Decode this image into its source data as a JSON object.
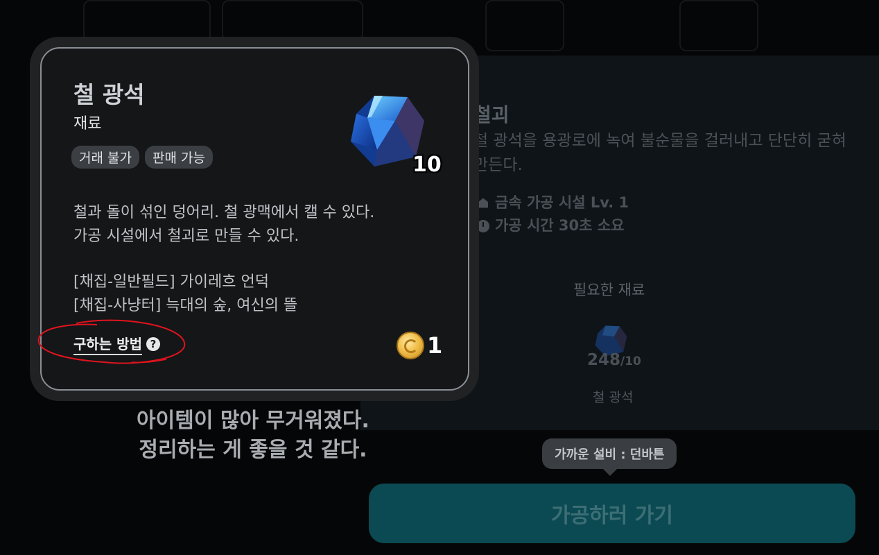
{
  "item": {
    "name": "철 광석",
    "type": "재료",
    "tags": [
      "거래 불가",
      "판매 가능"
    ],
    "quantity": "10",
    "description": [
      "철과 돌이 섞인 덩어리. 철 광맥에서 캘 수 있다.",
      "가공 시설에서 철괴로 만들 수 있다."
    ],
    "sources": [
      "[채집-일반필드] 가이레흐 언덕",
      "[채집-사냥터] 늑대의 숲, 여신의 뜰"
    ],
    "howto_label": "구하는 방법",
    "help_glyph": "?",
    "price": "1",
    "icons": {
      "gem": "iron-ore-gem-icon",
      "coin": "gold-coin-icon"
    }
  },
  "craft": {
    "title": "철괴",
    "description": "철 광석을 용광로에 녹여 불순물을 걸러내고 단단히 굳혀 만든다.",
    "facility": "금속 가공 시설 Lv. 1",
    "time": "가공 시간 30초 소요",
    "required_label": "필요한 재료",
    "material": {
      "owned": "248",
      "required": "/10",
      "name": "철 광석"
    },
    "nearest_facility": "가까운 설비 : 던바튼",
    "go_button": "가공하러 가기"
  },
  "message": {
    "line1": "아이템이 많아 무거워졌다.",
    "line2": "정리하는 게 좋을 것 같다."
  },
  "colors": {
    "accent_button": "#0b4a52",
    "card_border": "#8a8f95",
    "annotation": "#e0141e"
  }
}
